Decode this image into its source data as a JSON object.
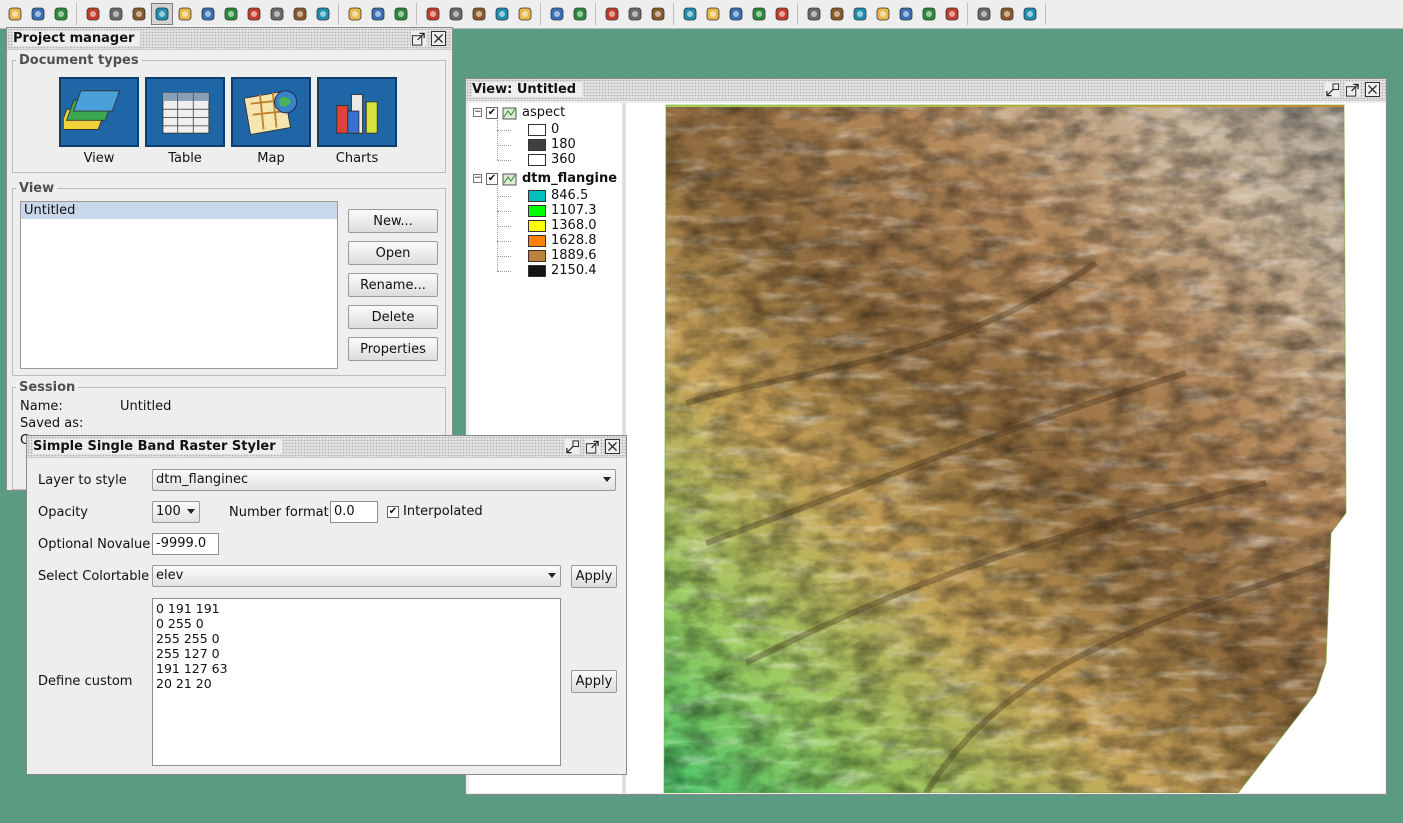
{
  "colors": {
    "desktop": "#5a9b82",
    "panel": "#eeeeee"
  },
  "toolbar": {
    "icons": [
      "new-doc-icon",
      "open-folder-icon",
      "save-icon",
      "pan-hand-icon",
      "zoom-full-icon",
      "zoom-select-icon",
      "zoom-in-icon",
      "zoom-out-icon",
      "layers-icon",
      "zoom-previous-icon",
      "zoom-back-icon",
      "find-icon",
      "select-layer-icon",
      "info-icon",
      "print-icon",
      "measure-icon",
      "select-pointer-icon",
      "select-rect-icon",
      "select-polygon-icon",
      "select-circle-icon",
      "clear-selection-icon",
      "stop-icon",
      "tools-icon",
      "add-layer-icon",
      "locate-icon",
      "flag-icon",
      "globe-icon",
      "raster-icon",
      "refresh-icon",
      "copy-icon",
      "edit-icon",
      "image-icon",
      "pin-icon",
      "pin2-icon",
      "text-m-icon",
      "pin3-icon",
      "pin4-icon",
      "pin5-icon",
      "lasso-icon",
      "table-icon",
      "folder-star-icon",
      "print-layout-icon"
    ]
  },
  "project_manager": {
    "title": "Project manager",
    "document_types_legend": "Document types",
    "doc_types": [
      {
        "label": "View",
        "icon": "view-doc-icon"
      },
      {
        "label": "Table",
        "icon": "table-doc-icon"
      },
      {
        "label": "Map",
        "icon": "map-doc-icon"
      },
      {
        "label": "Charts",
        "icon": "charts-doc-icon"
      }
    ],
    "view_legend": "View",
    "views": [
      "Untitled"
    ],
    "buttons": {
      "new": "New...",
      "open": "Open",
      "rename": "Rename...",
      "delete": "Delete",
      "properties": "Properties"
    },
    "session_legend": "Session",
    "session": {
      "name_label": "Name:",
      "name_value": "Untitled",
      "saved_label": "Saved as:",
      "c_label": "C"
    }
  },
  "view_window": {
    "title": "View: Untitled",
    "layers": [
      {
        "name": "aspect",
        "checked": true,
        "bold": false,
        "entries": [
          {
            "label": "0",
            "color": "#ffffff"
          },
          {
            "label": "180",
            "color": "#404040"
          },
          {
            "label": "360",
            "color": "#ffffff"
          }
        ]
      },
      {
        "name": "dtm_flangine",
        "checked": true,
        "bold": true,
        "entries": [
          {
            "label": "846.5",
            "color": "#00bfbf"
          },
          {
            "label": "1107.3",
            "color": "#00ff00"
          },
          {
            "label": "1368.0",
            "color": "#ffff00"
          },
          {
            "label": "1628.8",
            "color": "#ff7f00"
          },
          {
            "label": "1889.6",
            "color": "#bf7f3f"
          },
          {
            "label": "2150.4",
            "color": "#141514"
          }
        ]
      }
    ]
  },
  "styler": {
    "title": "Simple Single Band Raster Styler",
    "layer_label": "Layer to style",
    "layer_value": "dtm_flanginec",
    "opacity_label": "Opacity",
    "opacity_value": "100",
    "number_format_label": "Number format",
    "number_format_value": "0.0",
    "interpolated_label": "Interpolated",
    "interpolated": true,
    "novalue_label": "Optional Novalue",
    "novalue_value": "-9999.0",
    "colortable_label": "Select Colortable",
    "colortable_value": "elev",
    "apply_label": "Apply",
    "custom_label": "Define custom",
    "custom_lines": [
      "0 191 191",
      "0 255 0",
      "255 255 0",
      "255 127 0",
      "191 127 63",
      "20 21 20"
    ]
  }
}
